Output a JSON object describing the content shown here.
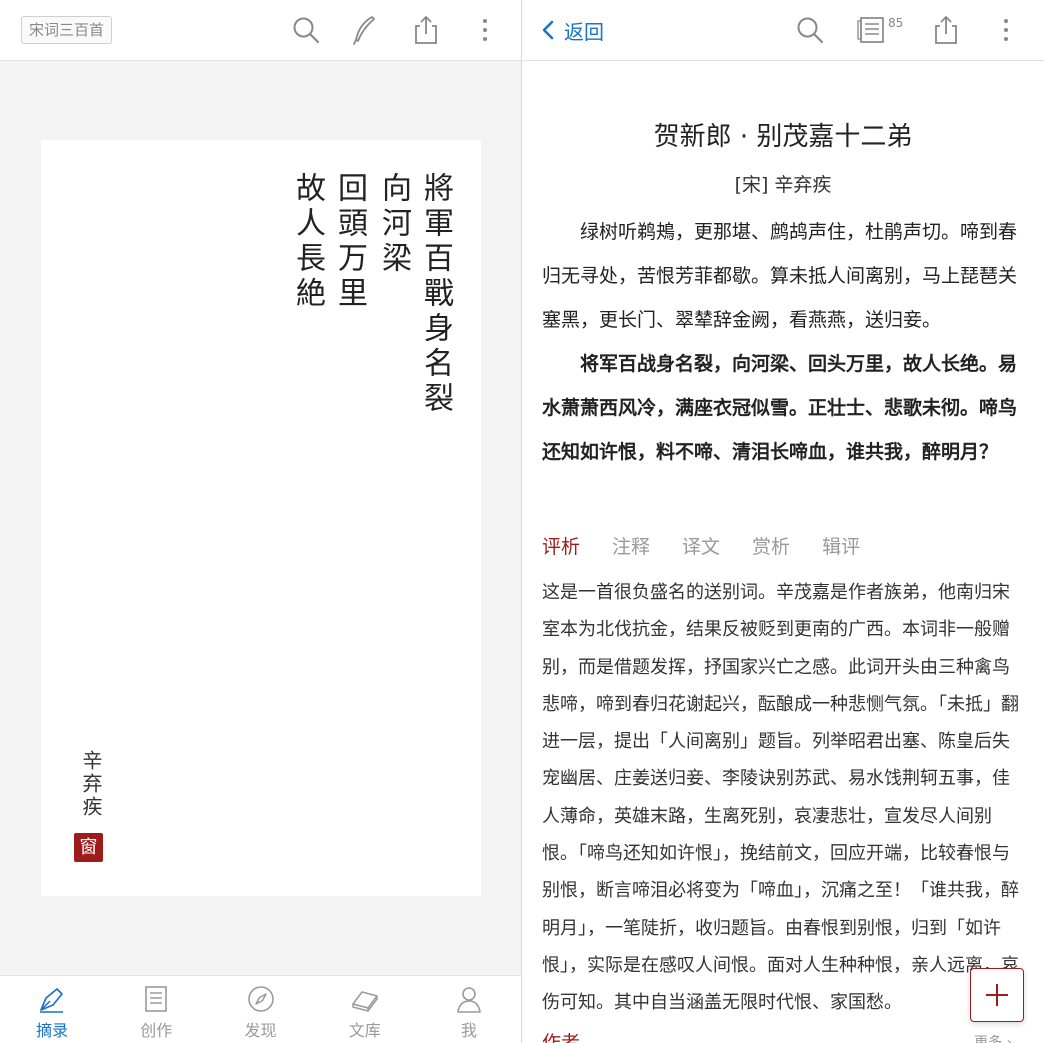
{
  "left": {
    "tag_chip": "宋词三百首",
    "card": {
      "columns": [
        "將軍百戰身名裂",
        "向河梁",
        "回頭万里",
        "故人長絶"
      ],
      "author": "辛弃疾",
      "seal": "窗"
    },
    "nav": {
      "items": [
        {
          "label": "摘录",
          "icon": "pen-nib-icon",
          "active": true
        },
        {
          "label": "创作",
          "icon": "document-icon",
          "active": false
        },
        {
          "label": "发现",
          "icon": "compass-icon",
          "active": false
        },
        {
          "label": "文库",
          "icon": "books-icon",
          "active": false
        },
        {
          "label": "我",
          "icon": "person-icon",
          "active": false
        }
      ]
    }
  },
  "right": {
    "back_label": "返回",
    "note_count": "85",
    "poem": {
      "title": "贺新郎 · 别茂嘉十二弟",
      "author": "[宋] 辛弃疾",
      "paragraphs": [
        "绿树听鹈鴂，更那堪、鹧鸪声住，杜鹃声切。啼到春归无寻处，苦恨芳菲都歇。算未抵人间离别，马上琵琶关塞黑，更长门、翠辇辞金阙，看燕燕，送归妾。",
        "将军百战身名裂，向河梁、回头万里，故人长绝。易水萧萧西风冷，满座衣冠似雪。正壮士、悲歌未彻。啼鸟还知如许恨，料不啼、清泪长啼血，谁共我，醉明月？"
      ]
    },
    "tabs": [
      "评析",
      "注释",
      "译文",
      "赏析",
      "辑评"
    ],
    "active_tab": 0,
    "analysis": "这是一首很负盛名的送别词。辛茂嘉是作者族弟，他南归宋室本为北伐抗金，结果反被贬到更南的广西。本词非一般赠别，而是借题发挥，抒国家兴亡之感。此词开头由三种禽鸟悲啼，啼到春归花谢起兴，酝酿成一种悲恻气氛。「未抵」翻进一层，提出「人间离别」题旨。列举昭君出塞、陈皇后失宠幽居、庄姜送归妾、李陵诀别苏武、易水饯荆轲五事，佳人薄命，英雄末路，生离死别，哀凄悲壮，宣发尽人间别恨。「啼鸟还知如许恨」，挽结前文，回应开端，比较春恨与别恨，断言啼泪必将变为「啼血」，沉痛之至！「谁共我，醉明月」，一笔陡折，收归题旨。由春恨到别恨，归到「如许恨」，实际是在感叹人间恨。面对人生种种恨，亲人远离，哀伤可知。其中自当涵盖无限时代恨、家国愁。",
    "section_author": "作者",
    "more_label": "更多 ›"
  },
  "colors": {
    "accent_blue": "#1a73c8",
    "accent_red": "#9e1b1b",
    "muted": "#999999"
  }
}
